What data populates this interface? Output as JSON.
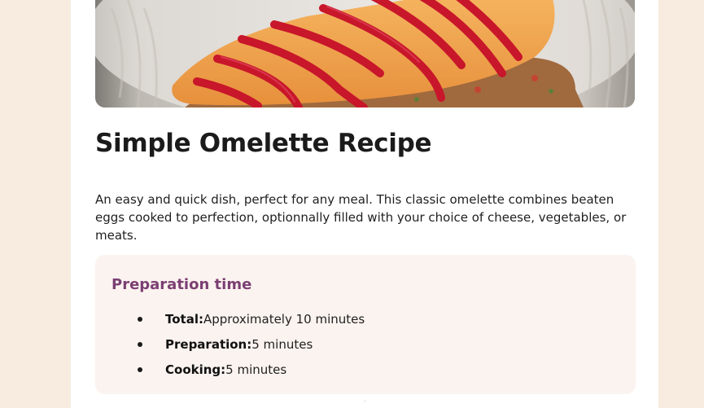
{
  "recipe": {
    "title": "Simple Omelette Recipe",
    "description": "An easy and quick dish, perfect for any meal. This classic omelette combines beaten eggs cooked to perfection, optionnally filled with your choice of cheese, vegetables, or meats."
  },
  "preparation": {
    "heading": "Preparation time",
    "items": [
      {
        "label": "Total:",
        "value": "Approximately 10 minutes"
      },
      {
        "label": "Preparation:",
        "value": "5 minutes"
      },
      {
        "label": "Cooking:",
        "value": "5 minutes"
      }
    ]
  },
  "colors": {
    "page_background": "#f8ece0",
    "card_background": "#ffffff",
    "prep_box_background": "#fbf3ef",
    "prep_heading": "#7b3f73",
    "ketchup": "#c8162b",
    "omelette": "#f0a24a"
  }
}
